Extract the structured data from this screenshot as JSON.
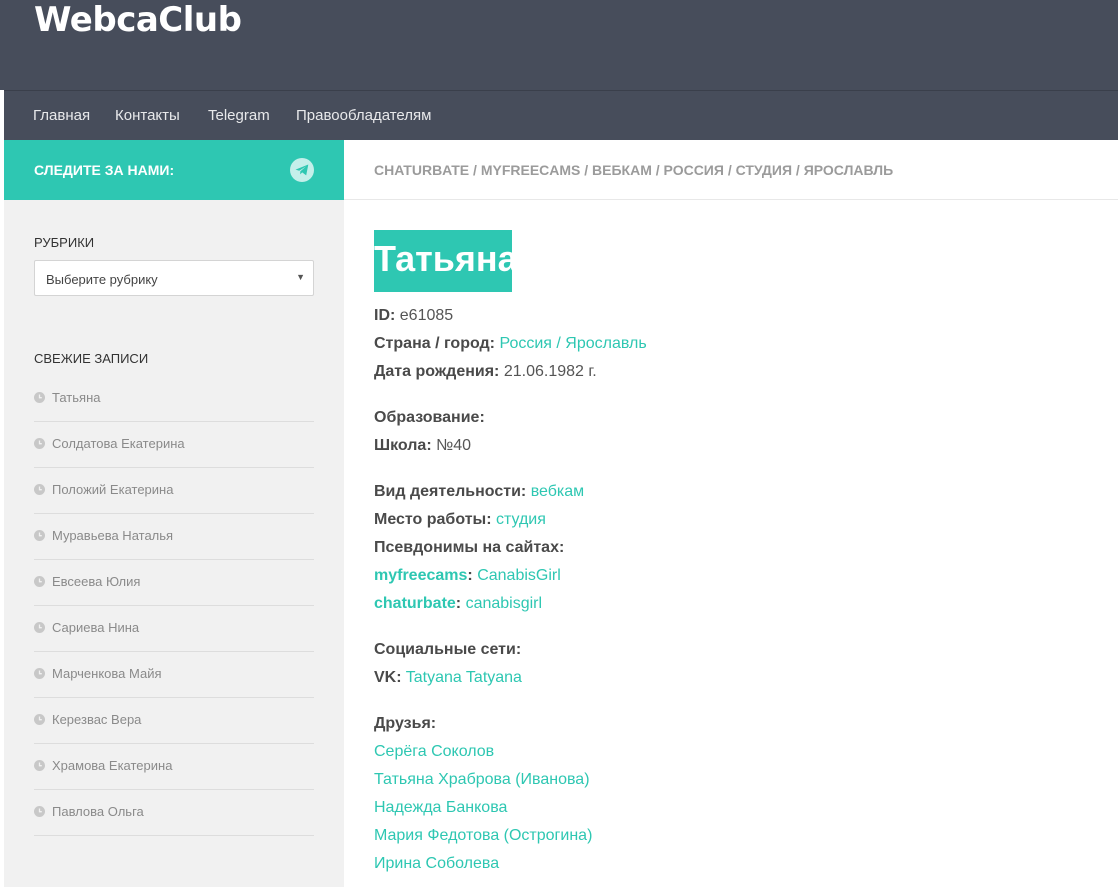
{
  "site": {
    "title": "WebcaClub"
  },
  "nav": [
    "Главная",
    "Контакты",
    "Telegram",
    "Правообладателям"
  ],
  "sidebar": {
    "follow_label": "СЛЕДИТЕ ЗА НАМИ:",
    "categories": {
      "title": "РУБРИКИ",
      "select_value": "Выберите рубрику"
    },
    "recent": {
      "title": "СВЕЖИЕ ЗАПИСИ",
      "items": [
        "Татьяна",
        "Солдатова Екатерина",
        "Положий Екатерина",
        "Муравьева Наталья",
        "Евсеева Юлия",
        "Сариева Нина",
        "Марченкова Майя",
        "Керезвас Вера",
        "Храмова Екатерина",
        "Павлова Ольга"
      ]
    }
  },
  "breadcrumb": [
    "CHATURBATE",
    "MYFREECAMS",
    "ВЕБКАМ",
    "РОССИЯ",
    "СТУДИЯ",
    "ЯРОСЛАВЛЬ"
  ],
  "breadcrumb_sep": " / ",
  "post": {
    "title": "Татьяна",
    "id_label": "ID:",
    "id_value": "e61085",
    "country_label": "Страна / город:",
    "country": "Россия",
    "city_sep": " / ",
    "city": "Ярославль",
    "birth_label": "Дата рождения:",
    "birth_value": "21.06.1982 г.",
    "education_label": "Образование:",
    "school_label": "Школа:",
    "school_value": "№40",
    "activity_label": "Вид деятельности:",
    "activity_value": "вебкам",
    "work_label": "Место работы:",
    "work_value": "студия",
    "aliases_label": "Псевдонимы на сайтах:",
    "aliases": [
      {
        "site": "myfreecams",
        "name": "CanabisGirl"
      },
      {
        "site": "chaturbate",
        "name": "canabisgirl"
      }
    ],
    "social_label": "Социальные сети:",
    "vk_label": "VK:",
    "vk_value": "Tatyana Tatyana",
    "friends_label": "Друзья:",
    "friends": [
      "Серёга Соколов",
      "Татьяна Храброва (Иванова)",
      "Надежда Банкова",
      "Мария Федотова (Острогина)",
      "Ирина Соболева"
    ]
  },
  "colors": {
    "accent": "#2ec7b2",
    "header": "#474d5b",
    "sidebar": "#f1f1f1"
  }
}
